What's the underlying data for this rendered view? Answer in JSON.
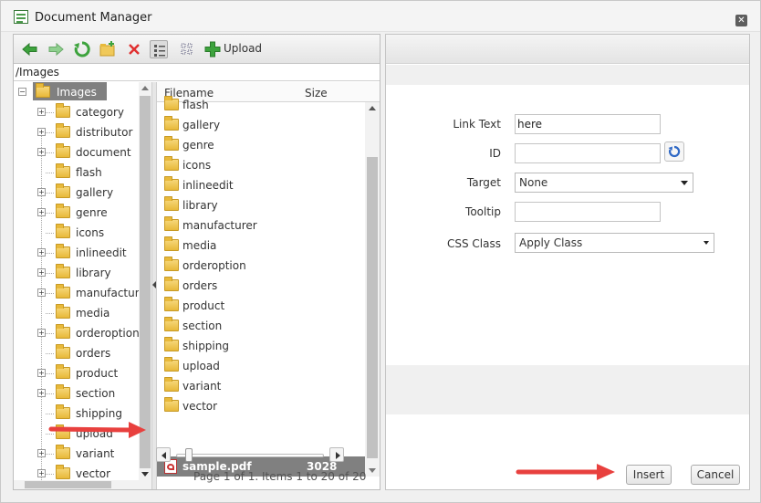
{
  "window": {
    "title": "Document Manager"
  },
  "toolbar": {
    "upload_label": "Upload"
  },
  "path": "/Images",
  "tree": {
    "root": "Images",
    "items": [
      {
        "label": "category",
        "expandable": true
      },
      {
        "label": "distributor",
        "expandable": true
      },
      {
        "label": "document",
        "expandable": true
      },
      {
        "label": "flash",
        "expandable": false
      },
      {
        "label": "gallery",
        "expandable": true
      },
      {
        "label": "genre",
        "expandable": true
      },
      {
        "label": "icons",
        "expandable": false
      },
      {
        "label": "inlineedit",
        "expandable": true
      },
      {
        "label": "library",
        "expandable": true
      },
      {
        "label": "manufacturer",
        "expandable": true
      },
      {
        "label": "media",
        "expandable": false
      },
      {
        "label": "orderoption",
        "expandable": true
      },
      {
        "label": "orders",
        "expandable": false
      },
      {
        "label": "product",
        "expandable": true
      },
      {
        "label": "section",
        "expandable": true
      },
      {
        "label": "shipping",
        "expandable": false
      },
      {
        "label": "upload",
        "expandable": false
      },
      {
        "label": "variant",
        "expandable": true
      },
      {
        "label": "vector",
        "expandable": true
      }
    ]
  },
  "files": {
    "columns": {
      "name": "Filename",
      "size": "Size"
    },
    "folders": [
      "flash",
      "gallery",
      "genre",
      "icons",
      "inlineedit",
      "library",
      "manufacturer",
      "media",
      "orderoption",
      "orders",
      "product",
      "section",
      "shipping",
      "upload",
      "variant",
      "vector"
    ],
    "selected_file": {
      "name": "sample.pdf",
      "size": "3028"
    },
    "pager": "Page 1 of 1. Items 1 to 20 of 20"
  },
  "form": {
    "link_text_label": "Link Text",
    "link_text_value": "here",
    "id_label": "ID",
    "id_value": "",
    "target_label": "Target",
    "target_value": "None",
    "tooltip_label": "Tooltip",
    "tooltip_value": "",
    "css_class_label": "CSS Class",
    "css_class_value": "Apply Class"
  },
  "buttons": {
    "insert": "Insert",
    "cancel": "Cancel"
  },
  "colors": {
    "annotation_arrow": "#e8403e",
    "selection": "#808080",
    "folder": "#f0c95a"
  }
}
